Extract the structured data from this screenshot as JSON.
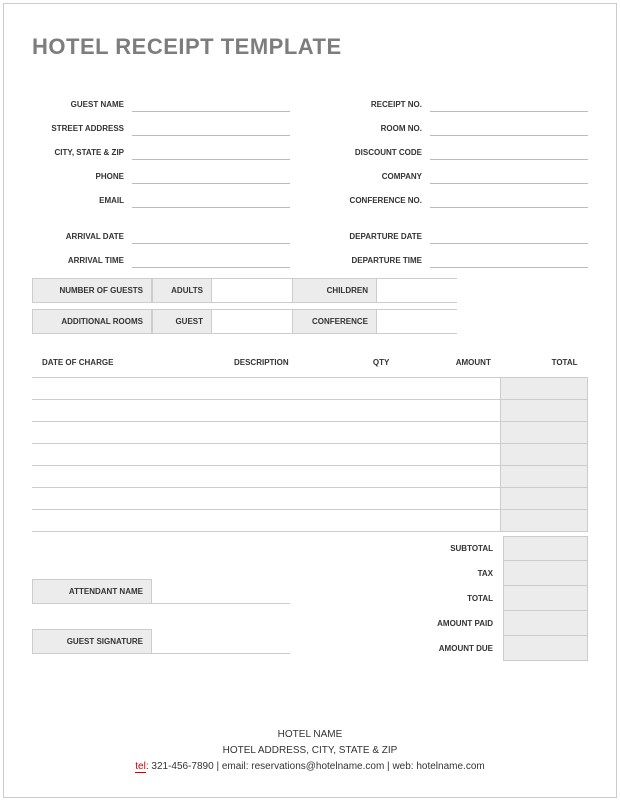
{
  "title": "HOTEL RECEIPT TEMPLATE",
  "left_labels": {
    "guest_name": "GUEST NAME",
    "street_address": "STREET ADDRESS",
    "city_state_zip": "CITY, STATE & ZIP",
    "phone": "PHONE",
    "email": "EMAIL",
    "arrival_date": "ARRIVAL DATE",
    "arrival_time": "ARRIVAL TIME"
  },
  "right_labels": {
    "receipt_no": "RECEIPT NO.",
    "room_no": "ROOM NO.",
    "discount_code": "DISCOUNT CODE",
    "company": "COMPANY",
    "conference_no": "CONFERENCE NO.",
    "departure_date": "DEPARTURE DATE",
    "departure_time": "DEPARTURE TIME"
  },
  "guest_block": {
    "number_of_guests": "NUMBER OF GUESTS",
    "adults": "ADULTS",
    "children": "CHILDREN",
    "additional_rooms": "ADDITIONAL ROOMS",
    "guest": "GUEST",
    "conference": "CONFERENCE"
  },
  "charges_headers": {
    "date": "DATE OF CHARGE",
    "description": "DESCRIPTION",
    "qty": "QTY",
    "amount": "AMOUNT",
    "total": "TOTAL"
  },
  "summary_labels": {
    "subtotal": "SUBTOTAL",
    "tax": "TAX",
    "total": "TOTAL",
    "amount_paid": "AMOUNT PAID",
    "amount_due": "AMOUNT DUE"
  },
  "signatures": {
    "attendant_name": "ATTENDANT NAME",
    "guest_signature": "GUEST SIGNATURE"
  },
  "footer": {
    "hotel_name": "HOTEL NAME",
    "hotel_address": "HOTEL ADDRESS, CITY, STATE & ZIP",
    "tel_label": "tel",
    "tel_value": ": 321-456-7890",
    "sep": "   |   ",
    "email_label": "email: ",
    "email_value": "reservations@hotelname.com",
    "web_label": "web: ",
    "web_value": "hotelname.com"
  }
}
